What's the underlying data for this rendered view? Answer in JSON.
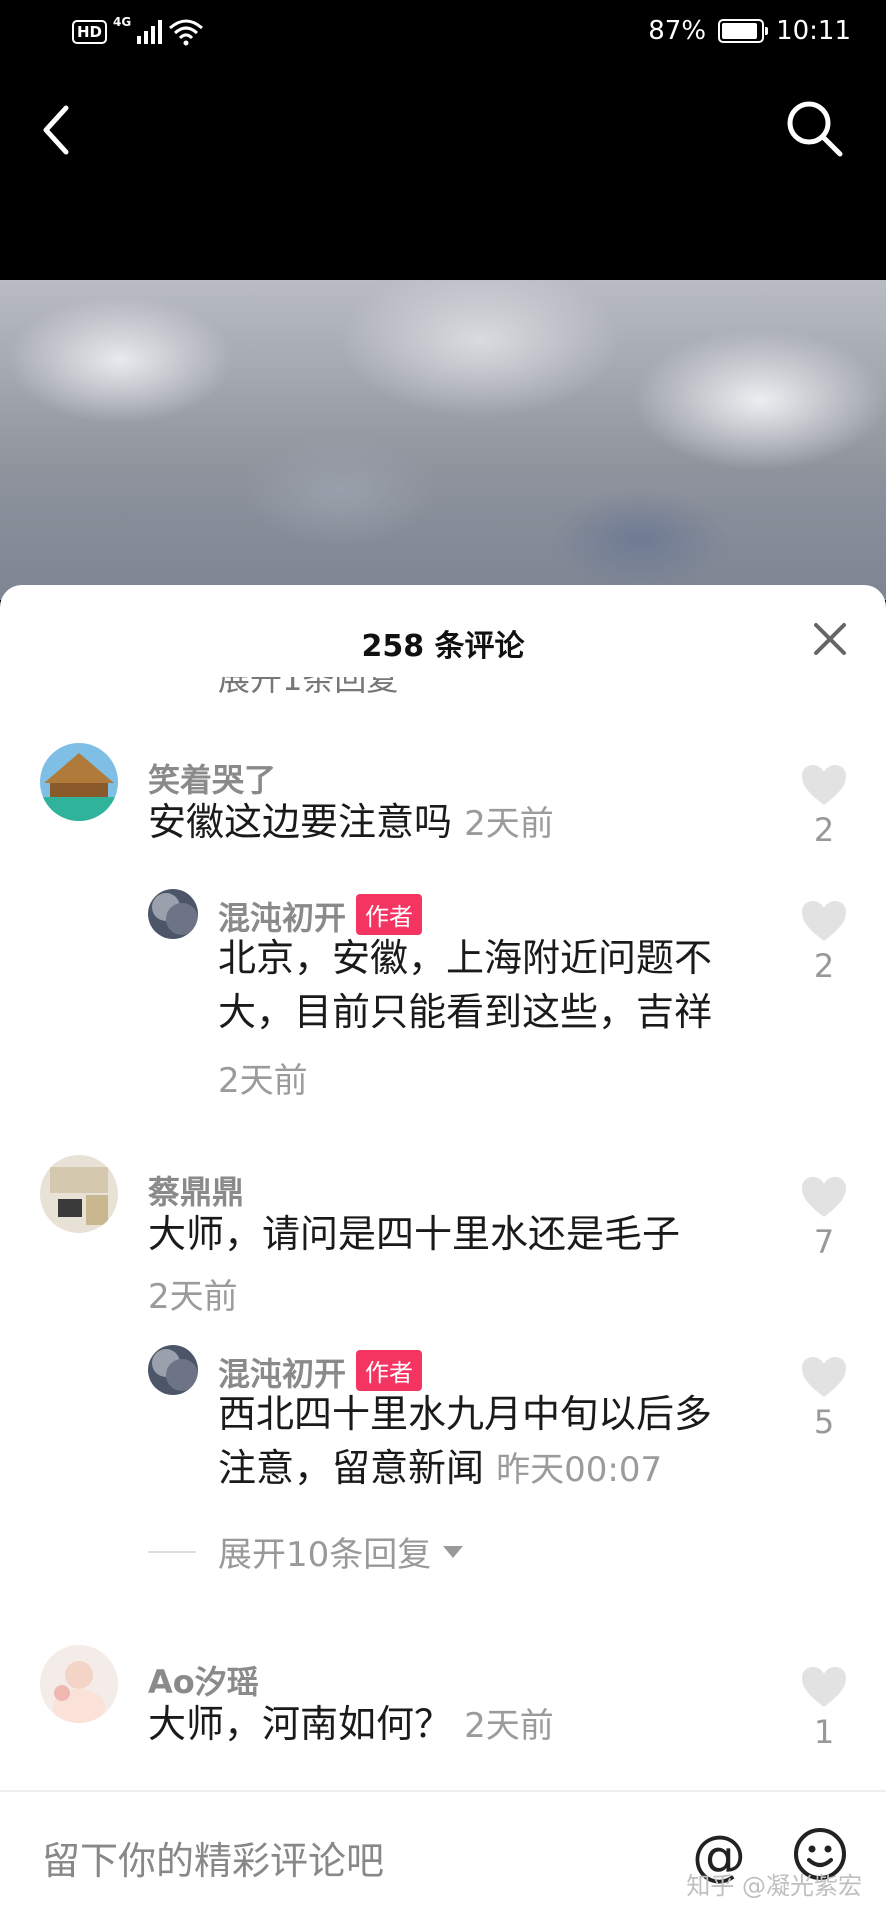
{
  "status_bar": {
    "hd": "HD",
    "network": "4G",
    "battery": "87%",
    "time": "10:11"
  },
  "comments_panel": {
    "title": "258 条评论",
    "partial_row": "展开1条回复"
  },
  "comments": [
    {
      "user": "笑着哭了",
      "text": "安徽这边要注意吗",
      "time": "2天前",
      "likes": "2",
      "reply": {
        "user": "混沌初开",
        "badge": "作者",
        "text_line1": "北京，安徽，上海附近问题不",
        "text_line2": "大，目前只能看到这些，吉祥",
        "time": "2天前",
        "likes": "2"
      }
    },
    {
      "user": "蔡鼎鼎",
      "text": "大师，请问是四十里水还是毛子",
      "time": "2天前",
      "likes": "7",
      "reply": {
        "user": "混沌初开",
        "badge": "作者",
        "text_line1": "西北四十里水九月中旬以后多",
        "text_line2": "注意，留意新闻",
        "time": "昨天00:07",
        "likes": "5"
      },
      "expand_label": "展开10条回复"
    },
    {
      "user": "Ao汐瑶",
      "text": "大师，河南如何？",
      "time": "2天前",
      "likes": "1"
    }
  ],
  "input": {
    "placeholder": "留下你的精彩评论吧",
    "at_symbol": "@"
  },
  "watermark": "知乎 @凝光紫宏",
  "icons": [
    "back-icon",
    "search-icon",
    "close-icon",
    "heart-icon",
    "emoji-icon",
    "at-icon"
  ]
}
